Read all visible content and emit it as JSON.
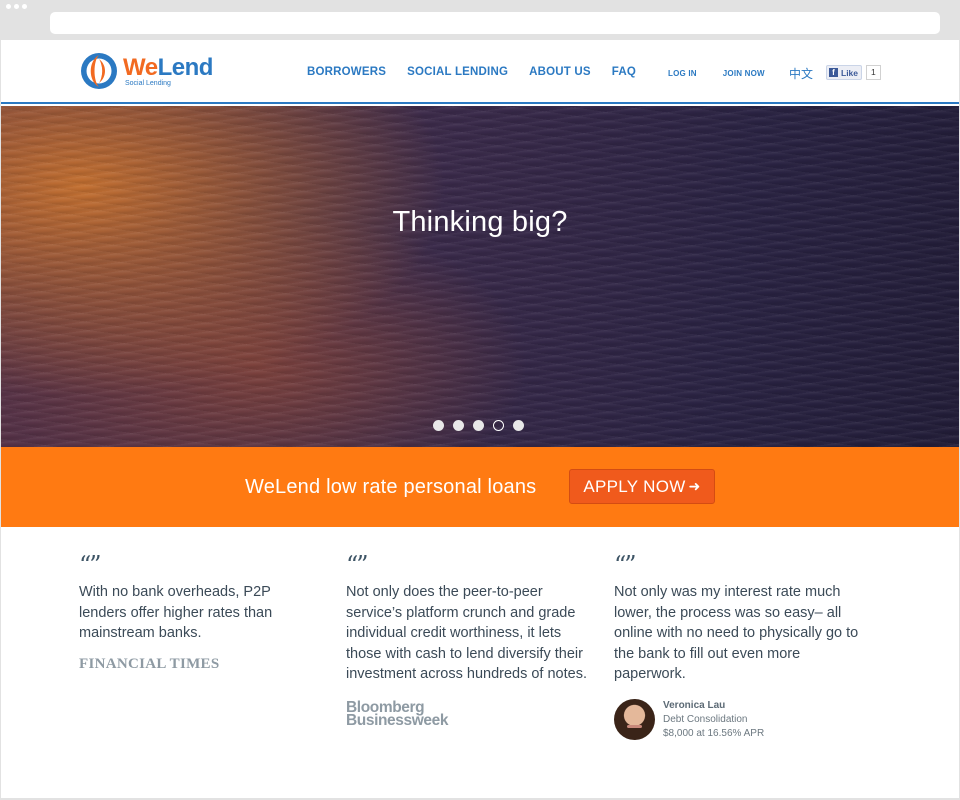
{
  "header": {
    "logo": {
      "name_we": "We",
      "name_lend": "Lend",
      "tagline": "Social Lending"
    },
    "nav_main": [
      "BORROWERS",
      "SOCIAL LENDING",
      "ABOUT US",
      "FAQ"
    ],
    "nav_small": [
      "LOG IN",
      "JOIN NOW"
    ],
    "language": "中文",
    "facebook": {
      "like_label": "Like",
      "count": "1"
    }
  },
  "hero": {
    "title": "Thinking big?",
    "slides": 5,
    "active_slide": 4
  },
  "band": {
    "text": "WeLend low rate personal loans",
    "apply_label": "APPLY NOW",
    "apply_arrow": "➜"
  },
  "testimonials": [
    {
      "quote_mark": "“”",
      "text": "With no bank overheads, P2P lenders offer higher rates than mainstream banks.",
      "source": "FINANCIAL TIMES"
    },
    {
      "quote_mark": "“”",
      "text": "Not only does the peer-to-peer service’s platform crunch and grade individual credit worthiness, it lets those with cash to lend diversify their investment across hundreds of notes.",
      "source_line1": "Bloomberg",
      "source_line2": "Businessweek"
    },
    {
      "quote_mark": "“”",
      "text": "Not only was my interest rate much lower, the process was so easy– all online with no need to physically go to the bank to fill out even more paperwork.",
      "person": {
        "name": "Veronica Lau",
        "purpose": "Debt Consolidation",
        "loan": "$8,000 at 16.56% APR"
      }
    }
  ],
  "colors": {
    "brand_blue": "#2b79c2",
    "brand_orange": "#f26a21",
    "band_orange": "#ff7a12",
    "button_orange": "#f05a1c"
  }
}
